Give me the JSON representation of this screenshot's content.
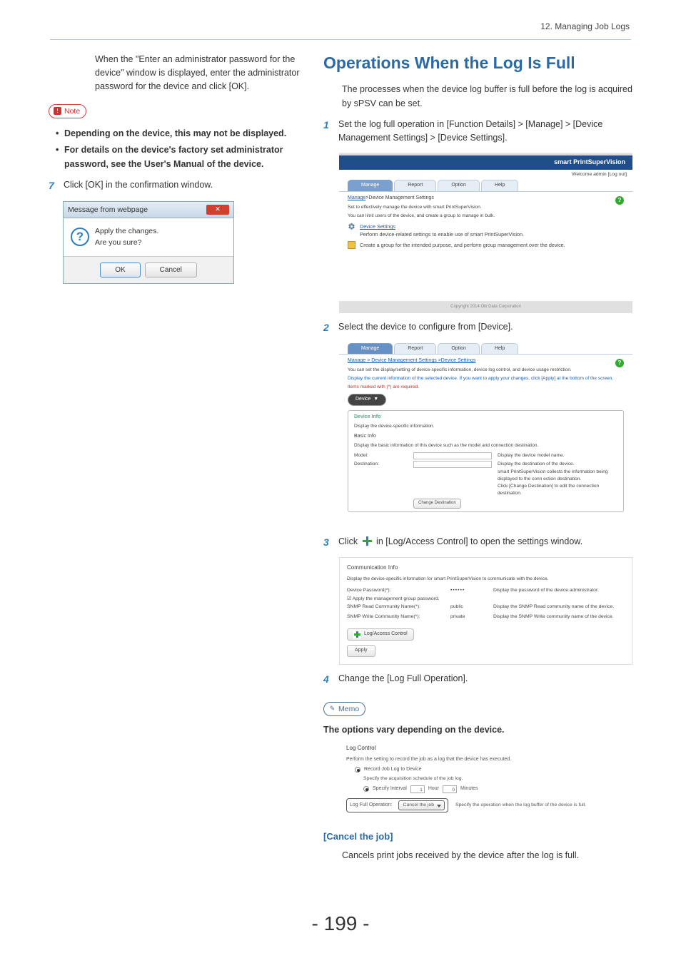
{
  "header": {
    "chapter": "12. Managing Job Logs"
  },
  "left": {
    "intro": "When the \"Enter an administrator password for the device\" window is displayed, enter the administrator password for the device and click [OK].",
    "note_label": "Note",
    "bullets": [
      "Depending on the device, this may not be displayed.",
      "For details on the device's factory set administrator password, see the User's Manual of the device."
    ],
    "step7_num": "7",
    "step7_text": "Click [OK] in the confirmation window.",
    "dialog": {
      "title": "Message from webpage",
      "line1": "Apply the changes.",
      "line2": "Are you sure?",
      "ok": "OK",
      "cancel": "Cancel"
    }
  },
  "right": {
    "title": "Operations When the Log Is Full",
    "intro": "The processes when the device log buffer is full before the log is acquired by sPSV can be set.",
    "steps": {
      "s1_num": "1",
      "s1_text": "Set the log full operation in [Function Details] > [Manage] > [Device Management Settings] > [Device Settings].",
      "s2_num": "2",
      "s2_text": "Select the device to configure from [Device].",
      "s3_num": "3",
      "s3_text_a": "Click ",
      "s3_text_b": " in [Log/Access Control] to open the settings window.",
      "s4_num": "4",
      "s4_text": "Change the [Log Full Operation]."
    },
    "shot1": {
      "brand": "smart PrintSuperVision",
      "welcome": "Welcome admin [Log out]",
      "tabs": [
        "Manage",
        "Report",
        "Option",
        "Help"
      ],
      "breadcrumb_a": "Manage",
      "breadcrumb_b": ">Device Management Settings",
      "sub1": "Set to effectively manage the device with smart PrintSuperVision.",
      "sub2": "You can limit users of the device, and create a group to manage in bulk.",
      "link1": "Device Settings",
      "desc1": "Perform device-related settings to enable use of smart PrintSuperVision.",
      "desc2": "Create a group for the intended purpose, and perform group management over the device.",
      "footer": "Copyright 2014 Oki Data Corporation"
    },
    "shot2": {
      "tabs": [
        "Manage",
        "Report",
        "Option",
        "Help"
      ],
      "breadcrumb": "Manage > Device Management Settings >Device Settings",
      "line1": "You can set the display/setting of device-specific information, device log control, and device usage restriction.",
      "line2": "Display the current information of the selected device. If you want to apply your changes, click [Apply] at the bottom of the screen.",
      "line3": "Items marked with (*) are required.",
      "selector_label": "Device",
      "box_hdr": "Device Info",
      "box_sub1": "Display the device-specific information.",
      "box_sub2": "Basic Info",
      "box_sub3": "Display the basic information of this device such as the model and connection destination.",
      "f_model": "Model:",
      "f_model_desc": "Display the device model name.",
      "f_dest": "Destination:",
      "f_dest_desc1": "Display the destination of the device.",
      "f_dest_desc2": "smart PrintSuperVision collects the information being displayed to the conn ection destination.",
      "f_dest_desc3": "Click [Change Destination] to edit the connection destination.",
      "chg_btn": "Change Destination"
    },
    "shot3": {
      "hdr": "Communication Info",
      "sub": "Display the device-specific information for smart PrintSuperVision to communicate with the device.",
      "r1_label": "Device Password(*):",
      "r1_val": "••••••",
      "r1_desc": "Display the password of the device administrator.",
      "chk_label": "Apply the management group password.",
      "r2_label": "SNMP Read Community Name(*):",
      "r2_val": "public",
      "r2_desc": "Display the SNMP Read community name of the device.",
      "r3_label": "SNMP Write Community Name(*):",
      "r3_val": "private",
      "r3_desc": "Display the SNMP Write community name of the device.",
      "expand": "Log/Access Control",
      "apply": "Apply"
    },
    "memo_label": "Memo",
    "memo_text": "The options vary depending on the device.",
    "shot4": {
      "hdr": "Log Control",
      "sub": "Perform the setting to record the job as a log that the device has executed.",
      "r1": "Record Job Log to Device",
      "r2": "Specify the acquisition schedule of the job log.",
      "r3a": "Specify Interval",
      "r3_v1": "1",
      "r3_hour": "Hour",
      "r3_v2": "0",
      "r3_min": "Minutes",
      "lfo_label": "Log Full Operation:",
      "lfo_val": "Cancel the job",
      "lfo_desc": "Specify the operation when the log buffer of the device is full."
    },
    "cancel_hdr": "[Cancel the job]",
    "cancel_text": "Cancels print jobs received by the device after the log is full."
  },
  "page_number": "- 199 -"
}
